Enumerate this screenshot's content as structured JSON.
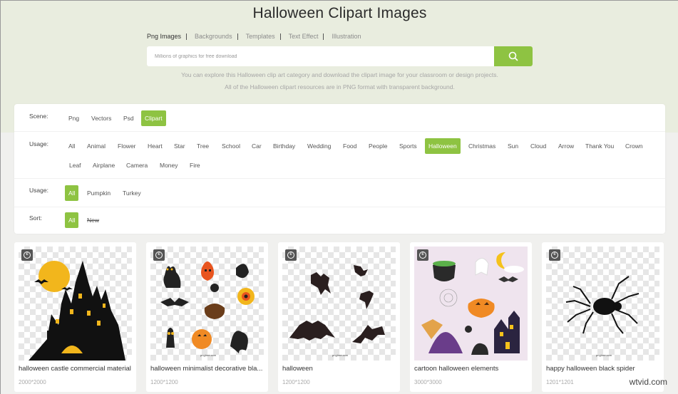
{
  "page": {
    "title": "Halloween Clipart Images",
    "tabs": [
      "Png Images",
      "Backgrounds",
      "Templates",
      "Text Effect",
      "Illustration"
    ],
    "search_placeholder": "Millions of graphics for free download",
    "description_line1": "You can explore this Halloween clip art category and download the clipart image for your classroom or design projects.",
    "description_line2": "All of the Halloween clipart resources are in PNG format with transparent background."
  },
  "filters": {
    "scene": {
      "label": "Scene:",
      "options": [
        "Png",
        "Vectors",
        "Psd",
        "Clipart"
      ],
      "selected": "Clipart"
    },
    "usage": {
      "label": "Usage:",
      "options": [
        "All",
        "Animal",
        "Flower",
        "Heart",
        "Star",
        "Tree",
        "School",
        "Car",
        "Birthday",
        "Wedding",
        "Food",
        "People",
        "Sports",
        "Halloween",
        "Christmas",
        "Sun",
        "Cloud",
        "Arrow",
        "Thank You",
        "Crown",
        "Leaf",
        "Airplane",
        "Camera",
        "Money",
        "Fire"
      ],
      "selected": "Halloween"
    },
    "usage2": {
      "label": "Usage:",
      "options": [
        "All",
        "Pumpkin",
        "Turkey"
      ],
      "selected": "All"
    },
    "sort": {
      "label": "Sort:",
      "options": [
        "All",
        "New"
      ],
      "selected": "All"
    }
  },
  "cards": [
    {
      "title": "halloween castle commercial material",
      "dims": "2000*2000",
      "icon": "haunted-castle-clipart"
    },
    {
      "title": "halloween minimalist decorative bla...",
      "dims": "1200*1200",
      "icon": "halloween-icons-collection"
    },
    {
      "title": "halloween",
      "dims": "1200*1200",
      "icon": "flying-bats-clipart"
    },
    {
      "title": "cartoon halloween elements",
      "dims": "3000*3000",
      "icon": "cartoon-halloween-scene"
    },
    {
      "title": "happy halloween black spider",
      "dims": "1201*1201",
      "icon": "black-spider-clipart"
    }
  ],
  "thumb_watermark": "pngtree.com",
  "copyright_symbol": "c",
  "watermark": "wtvid.com",
  "colors": {
    "accent": "#8ec342",
    "hero_bg": "#e9eddf"
  }
}
